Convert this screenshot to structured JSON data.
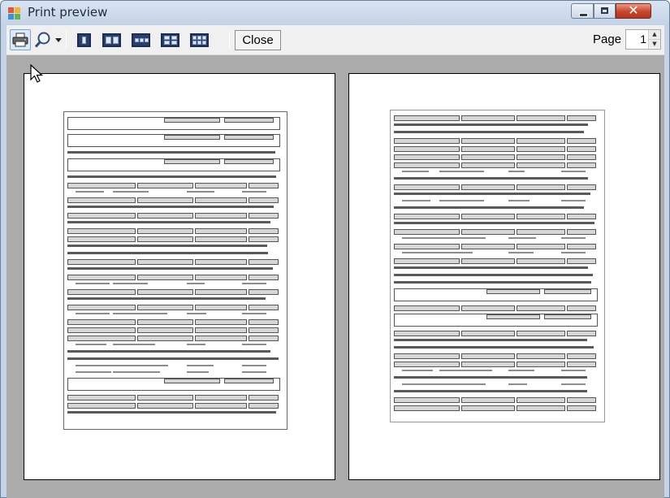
{
  "window": {
    "title": "Print preview",
    "close_glyph": "✕"
  },
  "toolbar": {
    "print_icon": "printer-icon",
    "zoom_icon": "magnifier-icon",
    "zoom_dropdown_icon": "chevron-down-icon",
    "page_layouts": [
      {
        "name": "one-page",
        "pages": 1
      },
      {
        "name": "two-pages",
        "pages": 2
      },
      {
        "name": "three-pages",
        "pages": 3
      },
      {
        "name": "four-pages",
        "pages": 4
      },
      {
        "name": "six-pages",
        "pages": 6
      }
    ],
    "close_label": "Close",
    "page_label": "Page",
    "page_value": "1"
  },
  "preview": {
    "pages_shown": 2
  },
  "colors": {
    "title_bar": "#c9d7ea",
    "preview_bg": "#ababab",
    "close_button_red": "#c8452c"
  }
}
